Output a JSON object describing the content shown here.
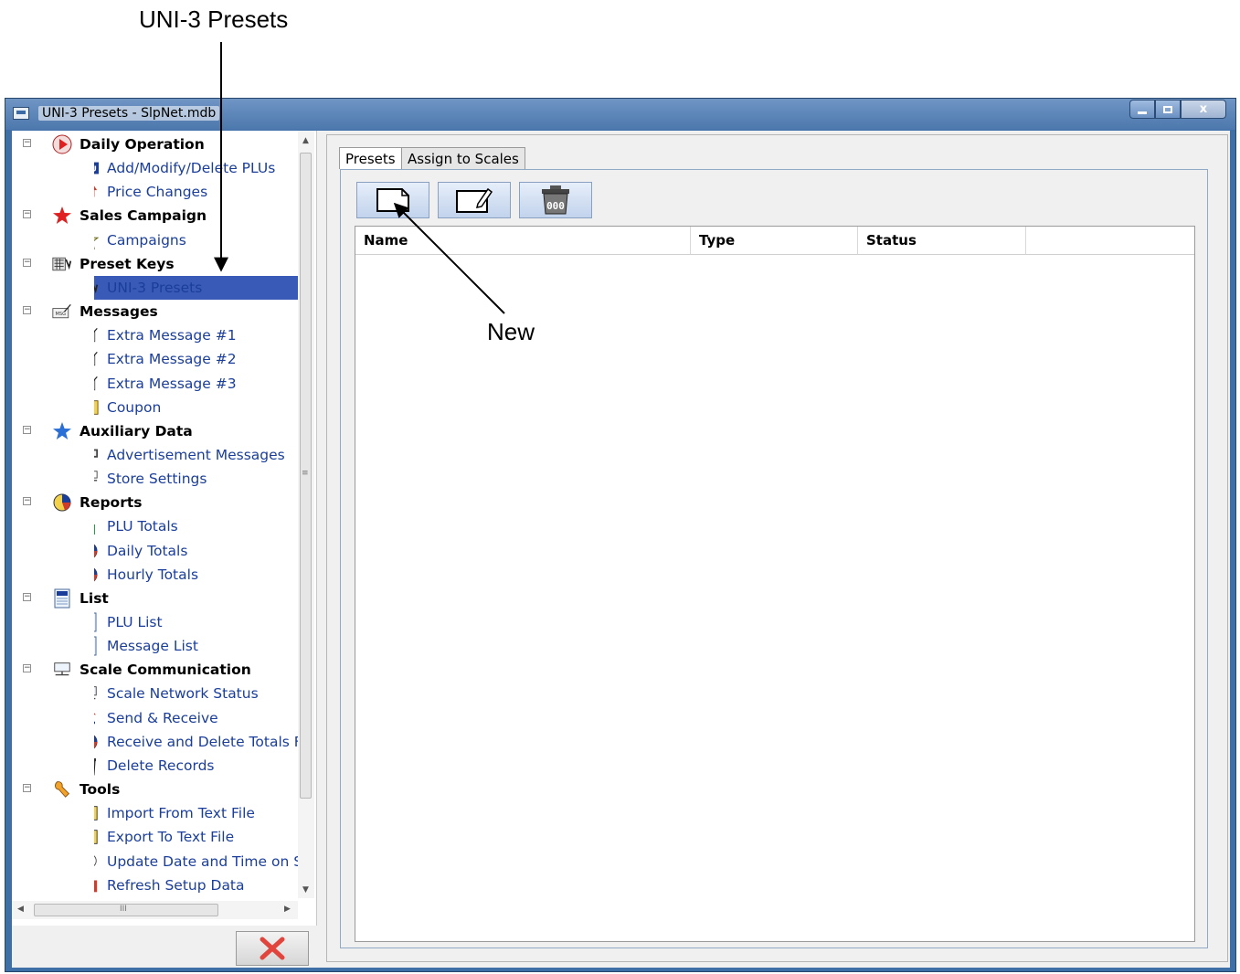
{
  "callouts": {
    "top_label": "UNI-3 Presets",
    "new_label": "New"
  },
  "window": {
    "title": "UNI-3 Presets - SlpNet.mdb",
    "controls": [
      "minimize",
      "maximize",
      "close"
    ],
    "close_glyph": "x"
  },
  "tree": {
    "items": [
      {
        "level": 0,
        "label": "Daily Operation",
        "icon": "play-icon"
      },
      {
        "level": 1,
        "label": "Add/Modify/Delete PLUs",
        "icon": "plu-icon"
      },
      {
        "level": 1,
        "label": "Price Changes",
        "icon": "price-change-icon"
      },
      {
        "level": 0,
        "label": "Sales Campaign",
        "icon": "red-star-icon"
      },
      {
        "level": 1,
        "label": "Campaigns",
        "icon": "star-outline-icon"
      },
      {
        "level": 0,
        "label": "Preset Keys",
        "icon": "keypad-icon"
      },
      {
        "level": 1,
        "label": "UNI-3 Presets",
        "icon": "keypad-icon",
        "selected": true
      },
      {
        "level": 0,
        "label": "Messages",
        "icon": "message-icon"
      },
      {
        "level": 1,
        "label": "Extra Message #1",
        "icon": "message-icon"
      },
      {
        "level": 1,
        "label": "Extra Message #2",
        "icon": "message-icon"
      },
      {
        "level": 1,
        "label": "Extra Message #3",
        "icon": "message-icon"
      },
      {
        "level": 1,
        "label": "Coupon",
        "icon": "coupon-icon"
      },
      {
        "level": 0,
        "label": "Auxiliary Data",
        "icon": "blue-star-icon"
      },
      {
        "level": 1,
        "label": "Advertisement Messages",
        "icon": "advert-icon"
      },
      {
        "level": 1,
        "label": "Store Settings",
        "icon": "store-icon"
      },
      {
        "level": 0,
        "label": "Reports",
        "icon": "pie-chart-icon"
      },
      {
        "level": 1,
        "label": "PLU Totals",
        "icon": "bar-chart-icon"
      },
      {
        "level": 1,
        "label": "Daily Totals",
        "icon": "pie-chart-icon"
      },
      {
        "level": 1,
        "label": "Hourly Totals",
        "icon": "pie-chart-icon"
      },
      {
        "level": 0,
        "label": "List",
        "icon": "list-icon"
      },
      {
        "level": 1,
        "label": "PLU List",
        "icon": "list-icon"
      },
      {
        "level": 1,
        "label": "Message List",
        "icon": "list-icon"
      },
      {
        "level": 0,
        "label": "Scale Communication",
        "icon": "network-icon"
      },
      {
        "level": 1,
        "label": "Scale Network Status",
        "icon": "network-icon"
      },
      {
        "level": 1,
        "label": "Send & Receive",
        "icon": "send-receive-icon"
      },
      {
        "level": 1,
        "label": "Receive and Delete Totals F",
        "icon": "pie-chart-icon"
      },
      {
        "level": 1,
        "label": "Delete Records",
        "icon": "trash-icon"
      },
      {
        "level": 0,
        "label": "Tools",
        "icon": "wrench-icon"
      },
      {
        "level": 1,
        "label": "Import From Text File",
        "icon": "import-icon"
      },
      {
        "level": 1,
        "label": "Export To Text File",
        "icon": "export-icon"
      },
      {
        "level": 1,
        "label": "Update Date and Time on S",
        "icon": "clock-icon"
      },
      {
        "level": 1,
        "label": "Refresh Setup Data",
        "icon": "book-icon"
      }
    ],
    "scroll_grip": "≡",
    "hscroll_grip": "III"
  },
  "tabs": [
    "Presets",
    "Assign to Scales"
  ],
  "toolbar": {
    "new_icon": "new-document-icon",
    "edit_icon": "edit-document-icon",
    "delete_icon": "trash-icon",
    "trash_text": "000"
  },
  "table": {
    "columns": [
      "Name",
      "Type",
      "Status"
    ]
  },
  "colors": {
    "selection": "#3a5ab8",
    "tree_link": "#1a3e9a",
    "window_frame": "#3e6fa7",
    "exit_x": "#e0443c"
  }
}
